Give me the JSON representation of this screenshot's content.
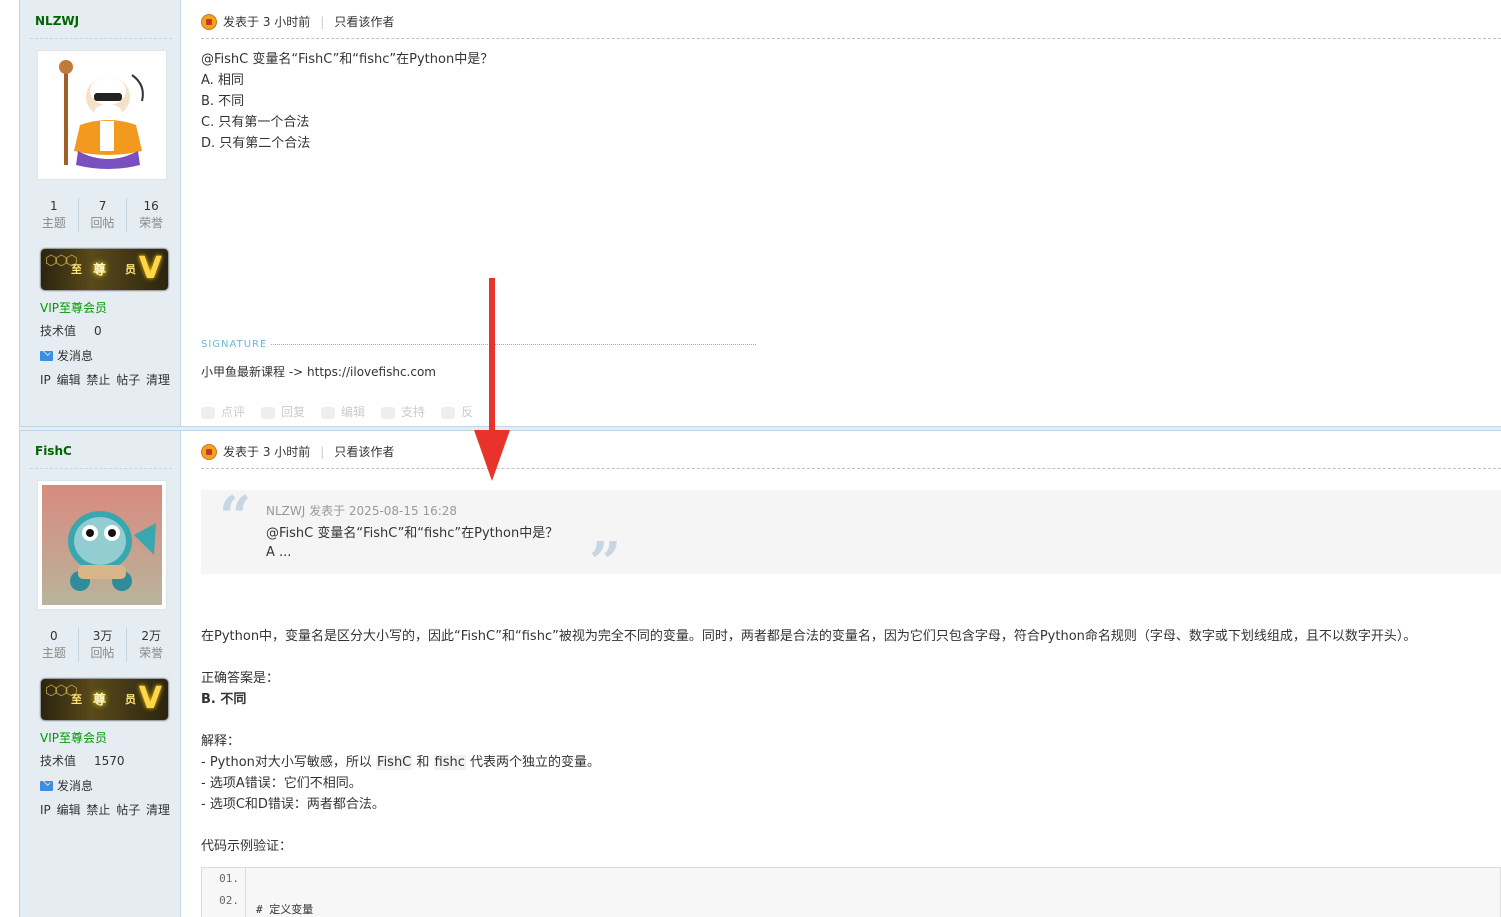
{
  "posts": [
    {
      "author": "NLZWJ",
      "stats": [
        {
          "value": "1",
          "label": "主题"
        },
        {
          "value": "7",
          "label": "回帖"
        },
        {
          "value": "16",
          "label": "荣誉"
        }
      ],
      "banner": {
        "a": "至",
        "b": "尊",
        "c": "员",
        "v": "V"
      },
      "group": "VIP至尊会员",
      "tech_label": "技术值",
      "tech_value": "0",
      "message": "发消息",
      "admin_links": "IP 编辑 禁止 帖子 清理",
      "posted": "发表于 3 小时前",
      "only_author": "只看该作者",
      "lines": [
        "@FishC 变量名“FishC”和“fishc”在Python中是？",
        "A. 相同",
        "B. 不同",
        "C. 只有第一个合法",
        "D. 只有第二个合法"
      ],
      "signature_label": "SIGNATURE",
      "signature": "小甲鱼最新课程 -> https://ilovefishc.com",
      "actions": [
        "点评",
        "回复",
        "编辑",
        "支持",
        "反"
      ]
    },
    {
      "author": "FishC",
      "stats": [
        {
          "value": "0",
          "label": "主题"
        },
        {
          "value": "3万",
          "label": "回帖"
        },
        {
          "value": "2万",
          "label": "荣誉"
        }
      ],
      "banner": {
        "a": "至",
        "b": "尊",
        "c": "员",
        "v": "V"
      },
      "group": "VIP至尊会员",
      "tech_label": "技术值",
      "tech_value": "1570",
      "message": "发消息",
      "admin_links": "IP 编辑 禁止 帖子 清理",
      "posted": "发表于 3 小时前",
      "only_author": "只看该作者",
      "quote": {
        "meta": "NLZWJ 发表于 2025-08-15 16:28",
        "line1": "@FishC 变量名“FishC”和“fishc”在Python中是？",
        "line2": "A ..."
      },
      "para": "在Python中，变量名是区分大小写的，因此“FishC”和“fishc”被视为完全不同的变量。同时，两者都是合法的变量名，因为它们只包含字母，符合Python命名规则（字母、数字或下划线组成，且不以数字开头）。",
      "answer_label": "正确答案是：",
      "answer": "B. 不同",
      "explain_label": "解释：",
      "explain1_pre": "- Python对大小写敏感，所以 ",
      "explain1_code1": "FishC",
      "explain1_mid": " 和 ",
      "explain1_code2": "fishc",
      "explain1_post": " 代表两个独立的变量。",
      "explain2": "- 选项A错误：它们不相同。",
      "explain3": "- 选项C和D错误：两者都合法。",
      "code_label": "代码示例验证：",
      "code_lines": [
        {
          "no": "01.",
          "text": ""
        },
        {
          "no": "02.",
          "text": "# 定义变量"
        }
      ]
    }
  ],
  "colors": {
    "sidebar": "#e5edf2",
    "group": "#009900",
    "arrow": "#e8332a"
  }
}
